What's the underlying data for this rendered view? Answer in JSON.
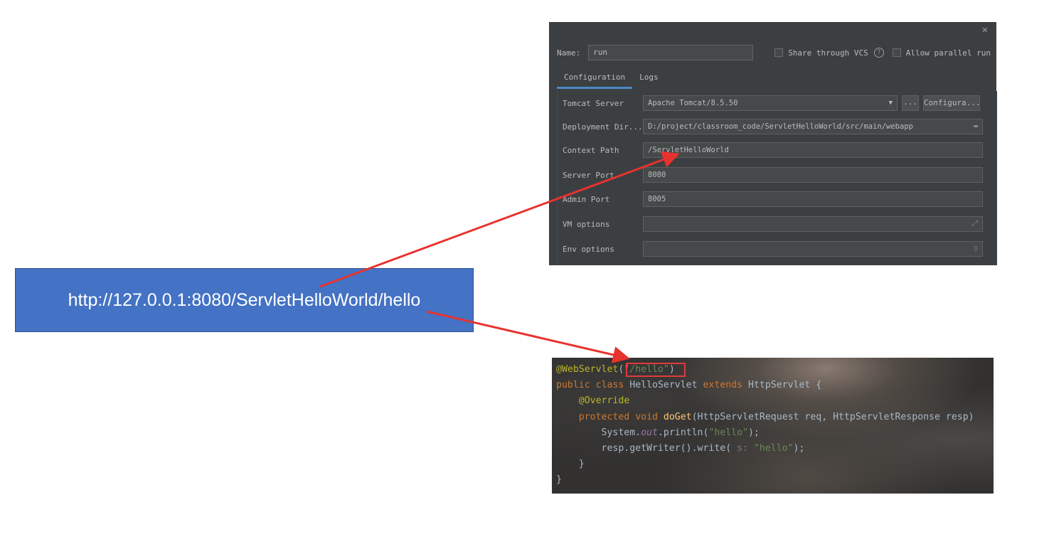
{
  "url_box": {
    "text": "http://127.0.0.1:8080/ServletHelloWorld/hello"
  },
  "dialog": {
    "name_label": "Name:",
    "name_value": "run",
    "share_vcs_label": "Share through VCS",
    "allow_parallel_label": "Allow parallel run",
    "tabs": [
      "Configuration",
      "Logs"
    ],
    "fields": {
      "tomcat_server_label": "Tomcat Server",
      "tomcat_server_value": "Apache Tomcat/8.5.50",
      "dots_label": "...",
      "configure_label": "Configura...",
      "deployment_dir_label": "Deployment Dir...",
      "deployment_dir_value": "D:/project/classroom_code/ServletHelloWorld/src/main/webapp",
      "context_path_label": "Context Path",
      "context_path_value": "/ServletHelloWorld",
      "server_port_label": "Server Port",
      "server_port_value": "8080",
      "admin_port_label": "Admin Port",
      "admin_port_value": "8005",
      "vm_options_label": "VM options",
      "env_options_label": "Env options"
    }
  },
  "code": {
    "annotation": "@WebServlet",
    "url_pattern": "\"/hello\"",
    "line2_public": "public",
    "line2_class": "class",
    "class_name": "HelloServlet",
    "extends_kw": "extends",
    "parent_class": "HttpServlet",
    "override": "@Override",
    "protected_kw": "protected",
    "void_kw": "void",
    "method": "doGet",
    "params": "(HttpServletRequest req, HttpServletResponse resp)",
    "line5_system": "System.",
    "line5_out": "out",
    "line5_println": ".println(",
    "str_hello": "\"hello\"",
    "line6_resp": "resp.getWriter().write(",
    "param_hint": "s:",
    "close_stmt": ");",
    "brace_open": "{",
    "brace_close": "}"
  },
  "colors": {
    "arrow": "#e8322e",
    "url_box_bg": "#4472c4",
    "dialog_bg": "#3c3f41",
    "tab_underline": "#4a88c7"
  }
}
